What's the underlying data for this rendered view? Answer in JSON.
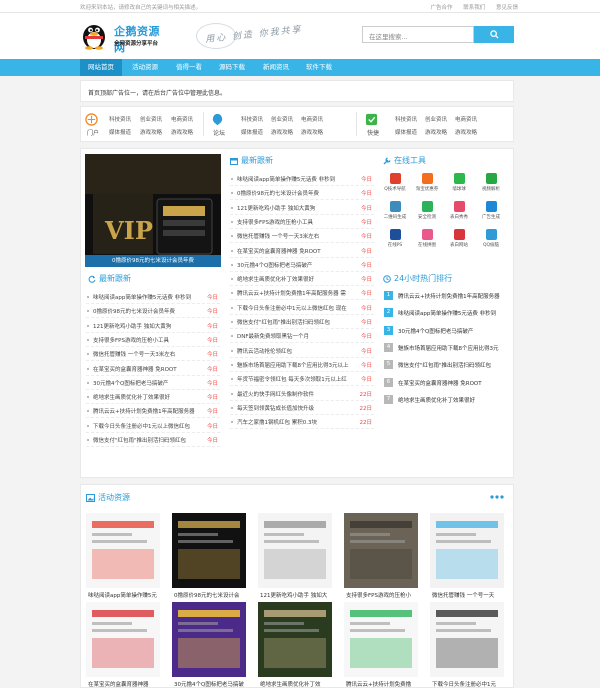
{
  "topbar": {
    "welcome": "欢迎来到本站，请修改自己的关键词与相关描述。",
    "links": [
      "广告合作",
      "联系我们",
      "意见反馈"
    ]
  },
  "header": {
    "logo_title": "企鹅资源网",
    "logo_sub": "全网资源分享平台",
    "slogan": "用心 创造 你我共享",
    "search_placeholder": "在这里搜索..."
  },
  "nav": {
    "items": [
      "网站首页",
      "活动资源",
      "值得一看",
      "源码下载",
      "新闻资讯",
      "软件下载"
    ]
  },
  "ad_banner": {
    "text": "首页顶部广告位一，请在后台广告位中管理此信息。"
  },
  "categories": [
    {
      "label": "门户",
      "links": [
        "科技资讯",
        "创业资讯",
        "电商资讯",
        "媒体报道",
        "游戏攻略",
        "游戏攻略"
      ]
    },
    {
      "label": "论坛",
      "links": [
        "科技资讯",
        "创业资讯",
        "电商资讯",
        "媒体报道",
        "游戏攻略",
        "游戏攻略"
      ]
    },
    {
      "label": "快捷",
      "links": [
        "科技资讯",
        "创业资讯",
        "电商资讯",
        "媒体报道",
        "游戏攻略",
        "游戏攻略"
      ]
    }
  ],
  "slide": {
    "caption": "0撸原价98元的七米设计会员年费"
  },
  "latest_right": {
    "title": "最新跟新",
    "rows": [
      {
        "t": "味哒阅读app简单操作赚5元话费 非秒到",
        "d": "今日"
      },
      {
        "t": "0撸原价98元的七米设计会员年费",
        "d": "今日"
      },
      {
        "t": "121更新吃鸡小助手 独如大黄狗",
        "d": "今日"
      },
      {
        "t": "支持很多FPS游戏的压枪小工具",
        "d": "今日"
      },
      {
        "t": "微信托管赚钱 一个号一天3米左右",
        "d": "今日"
      },
      {
        "t": "在某宝买的盒囊育器神器 免ROOT",
        "d": "今日"
      },
      {
        "t": "30元撸4个Q图标把老马搞破产",
        "d": "今日"
      },
      {
        "t": "绝地求生画质优化补丁效果很好",
        "d": "今日"
      },
      {
        "t": "腾讯云云+扶持计划免费撸1年高配服务器 需",
        "d": "今日"
      },
      {
        "t": "下载今日头条注册必中1元以上微信红包 现在",
        "d": "今日"
      },
      {
        "t": "微信支付\"红包雨\"推出别活扫码领红包",
        "d": "今日"
      },
      {
        "t": "DNF最新免费领取黑钻一个月",
        "d": "今日"
      },
      {
        "t": "腾讯云活动抢伦领红包",
        "d": "今日"
      },
      {
        "t": "魅族市场首届应用助下载8个应用比得3元以上",
        "d": "今日"
      },
      {
        "t": "年货节福密令领红包 每天多次领取1元以上红",
        "d": "今日"
      },
      {
        "t": "最近火的快手网红头像制作软件",
        "d": "22日"
      },
      {
        "t": "每天签到领黄钻成长值加快升级",
        "d": "22日"
      },
      {
        "t": "汽车之家撸1钢机红包 累积0.3块",
        "d": "22日"
      }
    ]
  },
  "latest_left": {
    "title": "最新跟新",
    "rows": [
      {
        "t": "味哒阅读app简单操作赚5元话费 非秒到",
        "d": "今日"
      },
      {
        "t": "0撸原价98元的七米设计会员年费",
        "d": "今日"
      },
      {
        "t": "121更新吃鸡小助手 独如大黄狗",
        "d": "今日"
      },
      {
        "t": "支持很多FPS游戏的压枪小工具",
        "d": "今日"
      },
      {
        "t": "微信托管赚钱 一个号一天3米左右",
        "d": "今日"
      },
      {
        "t": "在某宝买的盒囊育器神器 免ROOT",
        "d": "今日"
      },
      {
        "t": "30元撸4个Q图标把老马搞破产",
        "d": "今日"
      },
      {
        "t": "绝地求生画质优化补丁效果很好",
        "d": "今日"
      },
      {
        "t": "腾讯云云+扶持计划免费撸1年高配服务器",
        "d": "今日"
      },
      {
        "t": "下载今日头条注册必中1元以上微信红包",
        "d": "今日"
      },
      {
        "t": "微信支付\"红包雨\"推出别活扫码领红包",
        "d": "今日"
      }
    ]
  },
  "tools": {
    "title": "在线工具",
    "items": [
      {
        "label": "Q技术导航",
        "color": "#e0412c"
      },
      {
        "label": "淘宝优惠券",
        "color": "#f36f20"
      },
      {
        "label": "墙球球",
        "color": "#2db84d"
      },
      {
        "label": "视频解析",
        "color": "#28a745"
      },
      {
        "label": "二维码生成",
        "color": "#3c8dbc"
      },
      {
        "label": "安全检测",
        "color": "#2cb35a"
      },
      {
        "label": "表白秀秀",
        "color": "#e64b6b"
      },
      {
        "label": "广告生成",
        "color": "#1c88d6"
      },
      {
        "label": "在线PS",
        "color": "#1e4f9b"
      },
      {
        "label": "在线拼图",
        "color": "#e85a8c"
      },
      {
        "label": "表白网站",
        "color": "#d8343b"
      },
      {
        "label": "QQ偷脑",
        "color": "#2f9ad6"
      }
    ]
  },
  "ranking": {
    "title": "24小时热门排行",
    "items": [
      "腾讯云云+扶持计划免费撸1年高配服务器",
      "味哒阅读app简单操作赚5元话费 非秒到",
      "30元撸4个Q图标把老马搞破产",
      "魅族市场首届应用助下载8个应用比得3元",
      "微信支付\"红包雨\"推出别活扫码领红包",
      "在某宝买的盒囊育器神器 免ROOT",
      "绝地求生画质优化补丁效果很好"
    ]
  },
  "activity": {
    "title": "活动资源",
    "row1": [
      "味哒阅读app简单操作赚5元",
      "0撸原价98元的七米设计会",
      "121更新吃鸡小助手 独如大",
      "支持很多FPS游戏的压枪小",
      "微信托管赚钱 一个号一天"
    ],
    "row2": [
      "在某宝买的盒囊育器神器",
      "30元撸4个Q图标把老马搞破",
      "绝地求生画质优化补丁效",
      "腾讯云云+扶持计划免费撸",
      "下载今日头条注册必中1元"
    ]
  }
}
